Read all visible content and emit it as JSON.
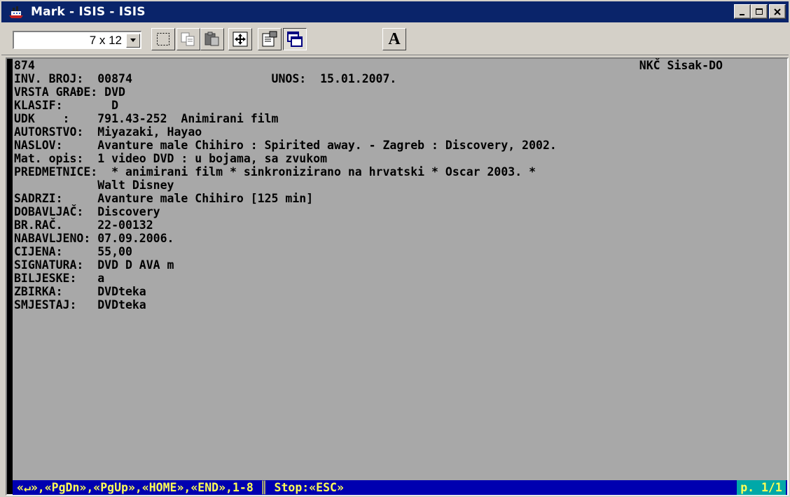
{
  "window": {
    "title": "Mark - ISIS - ISIS",
    "minimize_glyph": "_",
    "maximize_glyph": "□",
    "close_glyph": "×"
  },
  "toolbar": {
    "font_size_value": "7 x 12",
    "buttons": [
      "mark-icon",
      "copy-icon",
      "paste-icon",
      "fullscreen-icon",
      "properties-icon",
      "background-icon",
      "font-icon"
    ],
    "font_button_label": "A"
  },
  "record": {
    "header_number": "874",
    "header_library": "NKČ Sisak-DO",
    "lines": [
      "INV. BROJ:  00874                    UNOS:  15.01.2007.",
      "VRSTA GRAĐE: DVD",
      "KLASIF:       D",
      "UDK    :    791.43-252  Animirani film",
      "AUTORSTVO:  Miyazaki, Hayao",
      "NASLOV:     Avanture male Chihiro : Spirited away. - Zagreb : Discovery, 2002.",
      "Mat. opis:  1 video DVD : u bojama, sa zvukom",
      "PREDMETNICE:  * animirani film * sinkronizirano na hrvatski * Oscar 2003. *",
      "            Walt Disney",
      "SADRZI:     Avanture male Chihiro [125 min]",
      "DOBAVLJAČ:  Discovery",
      "BR.RAČ.     22-00132",
      "NABAVLJENO: 07.09.2006.",
      "CIJENA:     55,00",
      "SIGNATURA:  DVD D AVA m",
      "BILJESKE:   a",
      "ZBIRKA:     DVDteka",
      "SMJESTAJ:   DVDteka"
    ]
  },
  "status": {
    "keys": "«↵»,«PgDn»,«PgUp»,«HOME»,«END»,1-8 ║ Stop:«ESC»",
    "page": "p. 1/1"
  },
  "colors": {
    "titlebar": "#0a246a",
    "console_bg": "#a8a8a8",
    "status_bg": "#0000b0",
    "status_fg": "#ffff55",
    "page_bg": "#00a8a8"
  }
}
